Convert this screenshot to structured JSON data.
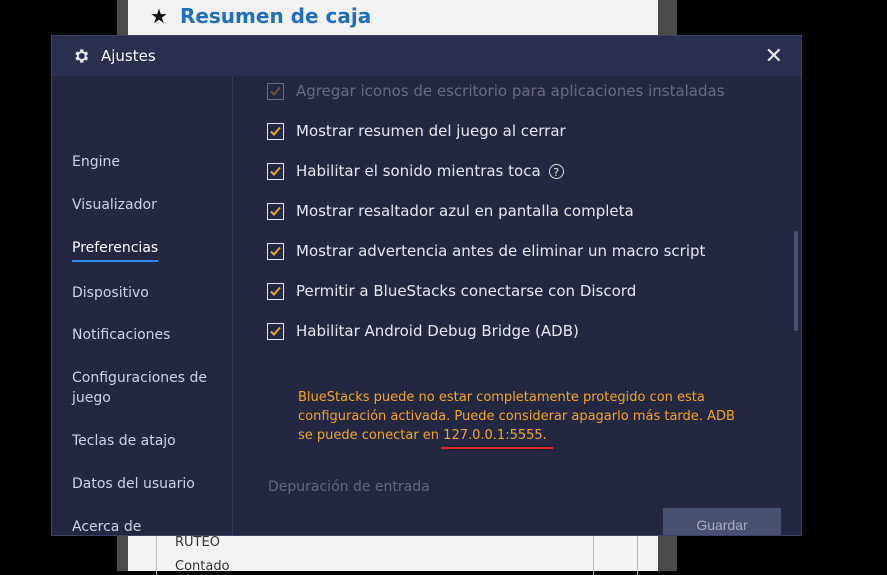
{
  "background": {
    "title": "Resumen de caja",
    "star_icon": "★",
    "rows": [
      "RUTEO",
      "Contado"
    ]
  },
  "dialog": {
    "title": "Ajustes",
    "close_glyph": "✕",
    "sidebar": {
      "items": [
        {
          "label": "Engine"
        },
        {
          "label": "Visualizador"
        },
        {
          "label": "Preferencias",
          "active": true
        },
        {
          "label": "Dispositivo"
        },
        {
          "label": "Notificaciones"
        },
        {
          "label": "Configuraciones de juego"
        },
        {
          "label": "Teclas de atajo"
        },
        {
          "label": "Datos del usuario"
        },
        {
          "label": "Acerca de"
        }
      ]
    },
    "options": [
      {
        "label": "Agregar iconos de escritorio para aplicaciones instaladas",
        "checked": true
      },
      {
        "label": "Mostrar resumen del juego al cerrar",
        "checked": true
      },
      {
        "label": "Habilitar el sonido mientras toca",
        "checked": true,
        "help": "?"
      },
      {
        "label": "Mostrar resaltador azul en pantalla completa",
        "checked": true
      },
      {
        "label": "Mostrar advertencia antes de eliminar un macro script",
        "checked": true
      },
      {
        "label": "Permitir a BlueStacks conectarse con Discord",
        "checked": true
      },
      {
        "label": "Habilitar Android Debug Bridge (ADB)",
        "checked": true
      }
    ],
    "adb_warning": {
      "text": "BlueStacks puede no estar completamente protegido con esta configuración activada. Puede considerar apagarlo más tarde. ADB se puede conectar en ",
      "address": "127.0.0.1:5555."
    },
    "next_section": "Depuración de entrada",
    "save_label": "Guardar",
    "colors": {
      "accent": "#2c8cf4",
      "checkbox": "#f5a623",
      "warning": "#f5a623",
      "underline": "#e02424"
    }
  }
}
